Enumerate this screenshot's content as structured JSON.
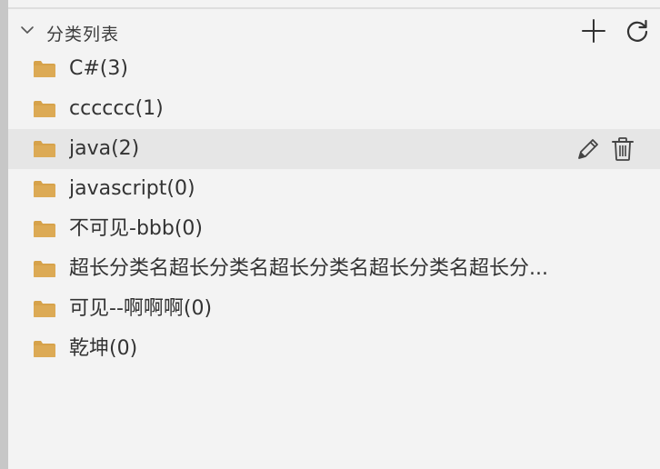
{
  "section": {
    "title": "分类列表",
    "expanded": true
  },
  "colors": {
    "folder": "#d6a24a",
    "selected_bg": "#e6e6e6",
    "text": "#333333"
  },
  "icons": {
    "collapse": "chevron-down-icon",
    "add": "plus-icon",
    "refresh": "refresh-icon",
    "folder": "folder-icon",
    "edit": "pencil-icon",
    "delete": "trash-icon"
  },
  "categories": [
    {
      "label": "C#(3)"
    },
    {
      "label": "cccccc(1)"
    },
    {
      "label": "java(2)",
      "selected": true
    },
    {
      "label": "javascript(0)"
    },
    {
      "label": "不可见-bbb(0)"
    },
    {
      "label": "超长分类名超长分类名超长分类名超长分类名超长分..."
    },
    {
      "label": "可见--啊啊啊(0)"
    },
    {
      "label": "乾坤(0)"
    }
  ]
}
